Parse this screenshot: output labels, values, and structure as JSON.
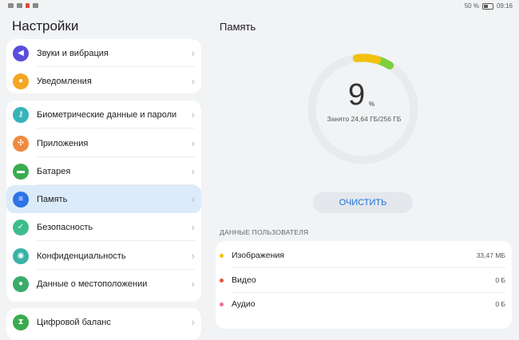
{
  "status_bar": {
    "battery_text": "50 %",
    "time": "09:16"
  },
  "settings": {
    "title": "Настройки",
    "groups": [
      {
        "items": [
          {
            "label": "Звуки и вибрация",
            "icon": "speaker-icon",
            "color": "#5a4fd8"
          },
          {
            "label": "Уведомления",
            "icon": "bell-icon",
            "color": "#f5a623"
          }
        ]
      },
      {
        "items": [
          {
            "label": "Биометрические данные и пароли",
            "icon": "key-icon",
            "color": "#37b3b8"
          },
          {
            "label": "Приложения",
            "icon": "apps-icon",
            "color": "#f08a3e"
          },
          {
            "label": "Батарея",
            "icon": "battery-icon",
            "color": "#3aab4e"
          },
          {
            "label": "Память",
            "icon": "storage-icon",
            "color": "#2d73e6",
            "selected": true
          },
          {
            "label": "Безопасность",
            "icon": "shield-icon",
            "color": "#3ebc8c"
          },
          {
            "label": "Конфиденциальность",
            "icon": "privacy-icon",
            "color": "#38b3a6"
          },
          {
            "label": "Данные о местоположении",
            "icon": "location-icon",
            "color": "#3aab6a"
          }
        ]
      },
      {
        "items": [
          {
            "label": "Цифровой баланс",
            "icon": "hourglass-icon",
            "color": "#3aab4e"
          }
        ]
      }
    ]
  },
  "storage": {
    "title": "Память",
    "percent": "9",
    "percent_sign": "%",
    "used_text": "Занято 24,64 ГБ/256 ГБ",
    "used_fraction": 0.096,
    "clean_label": "ОЧИСТИТЬ",
    "section_header": "ДАННЫЕ ПОЛЬЗОВАТЕЛЯ",
    "rows": [
      {
        "label": "Изображения",
        "value": "33,47 МБ",
        "color": "#f2c20f"
      },
      {
        "label": "Видео",
        "value": "0 Б",
        "color": "#e2543b"
      },
      {
        "label": "Аудио",
        "value": "0 Б",
        "color": "#e86fa0"
      }
    ],
    "ring_colors": {
      "track": "#e9eaec",
      "segment_yellow": "#f2c20f",
      "segment_green": "#7ccf3f"
    }
  }
}
